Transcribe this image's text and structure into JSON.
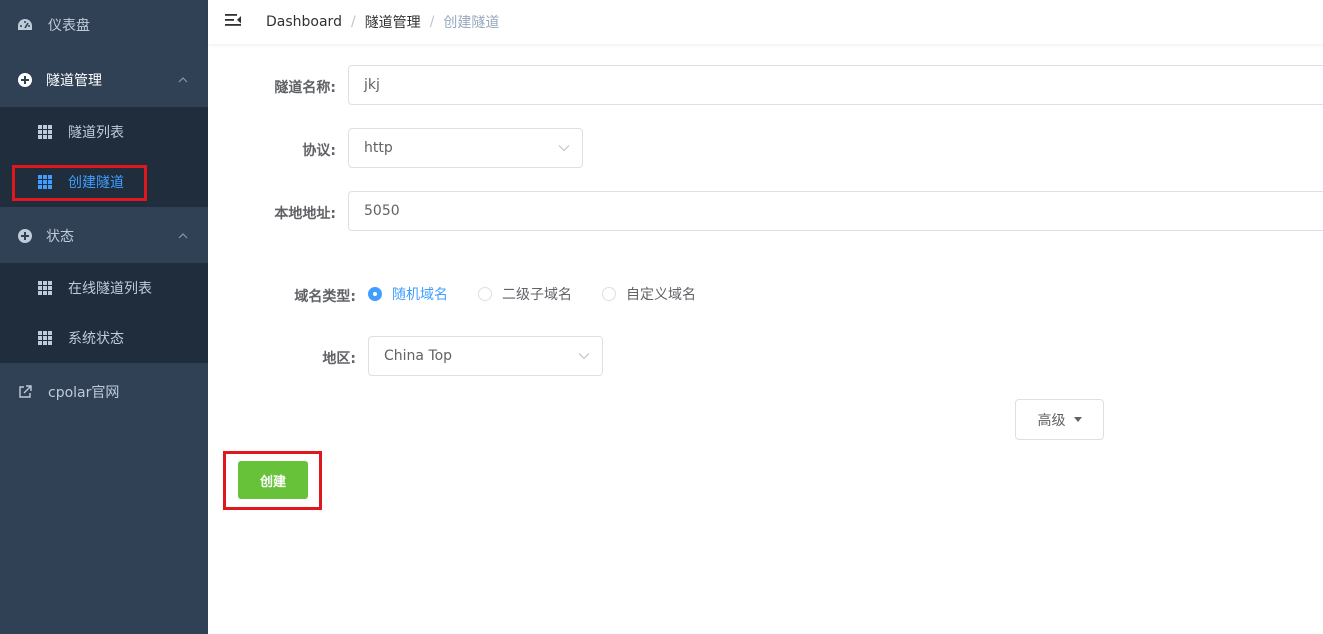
{
  "sidebar": {
    "dashboard": {
      "label": "仪表盘",
      "icon": "dashboard-gauge-icon"
    },
    "tunnel_mgmt": {
      "label": "隧道管理",
      "icon": "circle-plus-icon",
      "expanded": true
    },
    "tunnel_list": {
      "label": "隧道列表",
      "icon": "table-icon"
    },
    "create_tunnel": {
      "label": "创建隧道",
      "icon": "table-icon",
      "active": true
    },
    "status": {
      "label": "状态",
      "icon": "circle-plus-icon",
      "expanded": true
    },
    "online_tunnels": {
      "label": "在线隧道列表",
      "icon": "table-icon"
    },
    "system_status": {
      "label": "系统状态",
      "icon": "table-icon"
    },
    "cpolar_site": {
      "label": "cpolar官网",
      "icon": "external-link-icon"
    }
  },
  "navbar": {
    "breadcrumb": [
      "Dashboard",
      "隧道管理",
      "创建隧道"
    ],
    "separator": "/"
  },
  "form": {
    "tunnel_name": {
      "label": "隧道名称:",
      "value": "jkj"
    },
    "protocol": {
      "label": "协议:",
      "value": "http"
    },
    "local_address": {
      "label": "本地地址:",
      "value": "5050"
    },
    "domain_type": {
      "label": "域名类型:",
      "options": [
        "随机域名",
        "二级子域名",
        "自定义域名"
      ],
      "selected": "随机域名"
    },
    "region": {
      "label": "地区:",
      "value": "China Top"
    },
    "advanced_label": "高级",
    "submit_label": "创建"
  },
  "colors": {
    "sidebar_bg": "#304156",
    "submenu_bg": "#1f2d3d",
    "active": "#409eff",
    "submit": "#67c23a",
    "highlight": "#e0181d"
  }
}
